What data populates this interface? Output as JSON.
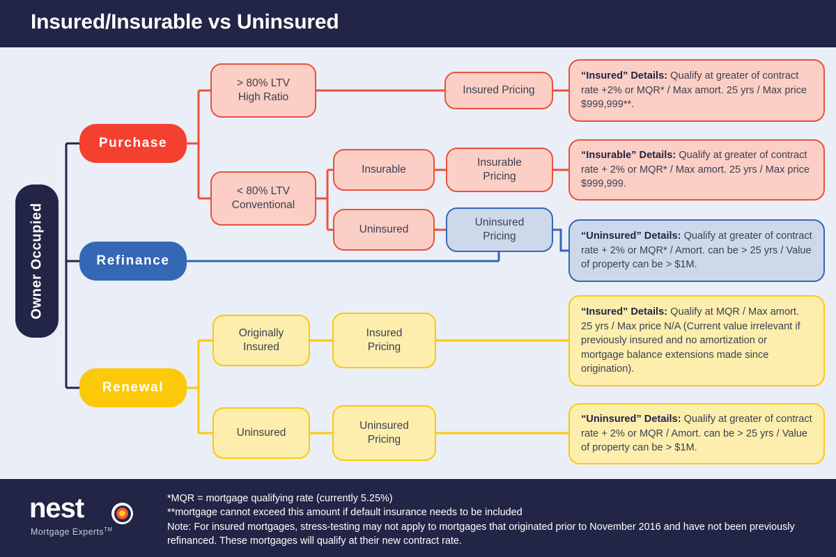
{
  "header": {
    "title": "Insured/Insurable vs Uninsured"
  },
  "root": {
    "label": "Owner Occupied"
  },
  "branches": {
    "purchase": "Purchase",
    "refinance": "Refinance",
    "renewal": "Renewal"
  },
  "nodes": {
    "high_ratio": "> 80% LTV\nHigh Ratio",
    "conventional": "< 80% LTV\nConventional",
    "insurable": "Insurable",
    "uninsured_purchase": "Uninsured",
    "insured_pricing_top": "Insured Pricing",
    "insurable_pricing": "Insurable\nPricing",
    "uninsured_pricing_mid": "Uninsured\nPricing",
    "originally_insured": "Originally\nInsured",
    "insured_pricing_renewal": "Insured\nPricing",
    "uninsured_renewal": "Uninsured",
    "uninsured_pricing_renewal": "Uninsured\nPricing"
  },
  "details": {
    "insured": {
      "title": "“Insured” Details:",
      "body": "  Qualify at greater of contract rate +2% or MQR* / Max amort. 25 yrs / Max price $999,999**."
    },
    "insurable": {
      "title": "“Insurable” Details:",
      "body": " Qualify at greater of contract rate + 2% or MQR* / Max amort. 25 yrs / Max price $999,999."
    },
    "uninsured": {
      "title": "“Uninsured” Details:",
      "body": " Qualify at greater of contract rate + 2% or MQR* / Amort. can be > 25 yrs / Value of property can be > $1M."
    },
    "renewal_insured": {
      "title": "“Insured” Details:",
      "body": " Qualify at MQR / Max amort. 25 yrs / Max price N/A  (Current value irrelevant if previously insured and no amortization or mortgage balance extensions made since origination)."
    },
    "renewal_uninsured": {
      "title": "“Uninsured” Details:",
      "body": " Qualify at greater of contract rate + 2% or MQR / Amort. can be > 25 yrs / Value of property can be > $1M."
    }
  },
  "footer": {
    "logo_word": "nest",
    "logo_tagline": "Mortgage Experts",
    "logo_tm": "TM",
    "note1": "*MQR = mortgage qualifying rate (currently 5.25%)",
    "note2": "**mortgage cannot exceed this amount if default insurance needs to be included",
    "note3": "Note: For insured mortgages, stress-testing may not apply to mortgages that originated prior to November 2016 and have not been previously refinanced. These mortgages will qualify at their new contract rate."
  },
  "colors": {
    "navy": "#222546",
    "background": "#eaeef7",
    "red": "#e8513c",
    "red_pill": "#f4402f",
    "red_fill": "#fbcfc5",
    "blue": "#3467b4",
    "blue_fill": "#cdd9ea",
    "yellow": "#fcc90a",
    "yellow_fill": "#fdeead"
  }
}
